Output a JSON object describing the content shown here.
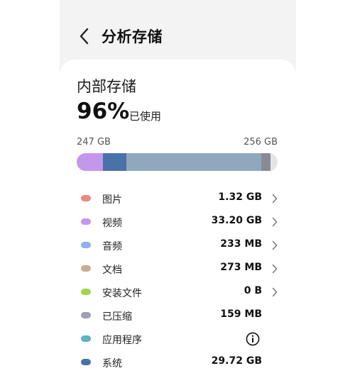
{
  "header": {
    "title": "分析存储"
  },
  "storage": {
    "title": "内部存储",
    "percent": "96%",
    "percent_label": "已使用",
    "used": "247 GB",
    "total": "256 GB",
    "used_fraction": 0.96
  },
  "bar_segments": [
    {
      "name": "视频",
      "color": "#c597ec",
      "fraction": 0.13
    },
    {
      "name": "系统",
      "color": "#4a72a8",
      "fraction": 0.116
    },
    {
      "name": "其他",
      "color": "#8fa8bd",
      "fraction": 0.674
    },
    {
      "name": "其他2",
      "color": "#8a8a96",
      "fraction": 0.045
    },
    {
      "name": "可用",
      "color": "#e4e4e4",
      "fraction": 0.035
    }
  ],
  "categories": [
    {
      "label": "图片",
      "value": "1.32 GB",
      "color": "#e98a80",
      "action": "chevron"
    },
    {
      "label": "视频",
      "value": "33.20 GB",
      "color": "#c597ec",
      "action": "chevron"
    },
    {
      "label": "音频",
      "value": "233 MB",
      "color": "#8db2ee",
      "action": "chevron"
    },
    {
      "label": "文档",
      "value": "273 MB",
      "color": "#c9ae8e",
      "action": "chevron"
    },
    {
      "label": "安装文件",
      "value": "0 B",
      "color": "#a2d64a",
      "action": "chevron"
    },
    {
      "label": "已压缩",
      "value": "159 MB",
      "color": "#9aa2b3",
      "action": "none"
    },
    {
      "label": "应用程序",
      "value": "",
      "color": "#5bb3c4",
      "action": "info"
    },
    {
      "label": "系统",
      "value": "29.72 GB",
      "color": "#4a72a8",
      "action": "none"
    }
  ]
}
